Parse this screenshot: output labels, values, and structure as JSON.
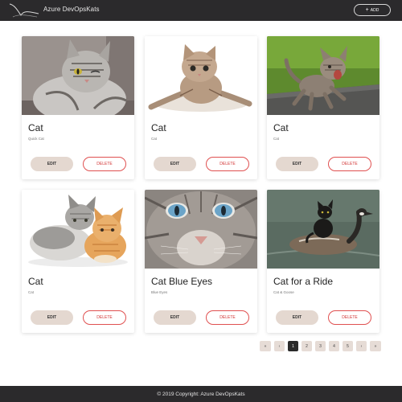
{
  "header": {
    "brand": "Azure DevOpsKats",
    "add_label": "ADD"
  },
  "cards": [
    {
      "title": "Cat",
      "subtitle": "Quick Cat",
      "edit": "EDIT",
      "delete": "DELETE"
    },
    {
      "title": "Cat",
      "subtitle": "Cat",
      "edit": "EDIT",
      "delete": "DELETE"
    },
    {
      "title": "Cat",
      "subtitle": "Cat",
      "edit": "EDIT",
      "delete": "DELETE"
    },
    {
      "title": "Cat",
      "subtitle": "Cat",
      "edit": "EDIT",
      "delete": "DELETE"
    },
    {
      "title": "Cat Blue Eyes",
      "subtitle": "Blue Eyes",
      "edit": "EDIT",
      "delete": "DELETE"
    },
    {
      "title": "Cat for a Ride",
      "subtitle": "Cat & Goose",
      "edit": "EDIT",
      "delete": "DELETE"
    }
  ],
  "pagination": {
    "first": "«",
    "prev": "‹",
    "pages": [
      "1",
      "2",
      "3",
      "4",
      "5"
    ],
    "next": "›",
    "last": "»",
    "active_page": "1"
  },
  "footer": {
    "copyright": "© 2019 Copyright: Azure DevOpsKats"
  },
  "colors": {
    "navbar": "#2b2a2c",
    "edit_button": "#e4d8d0",
    "delete_border": "#e05050",
    "page_button": "#e6dcd6",
    "active_page": "#2a2a2a"
  }
}
